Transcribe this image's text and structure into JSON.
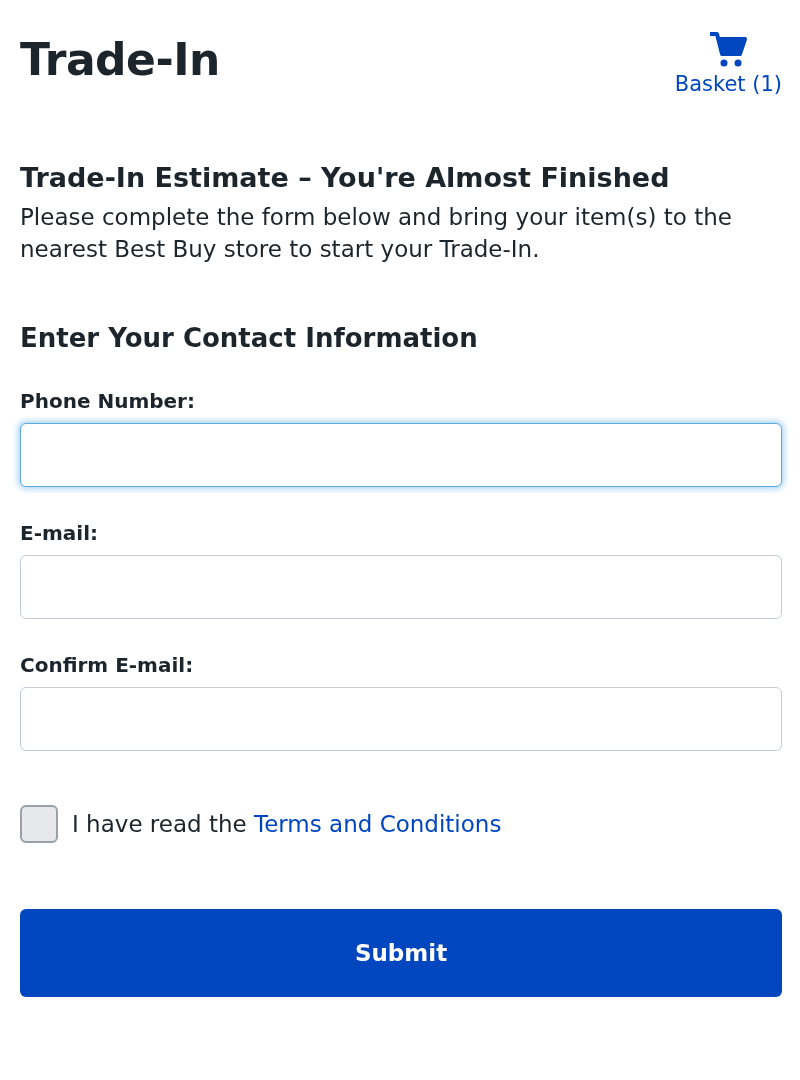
{
  "header": {
    "title": "Trade-In",
    "basket": {
      "label": "Basket (1)"
    }
  },
  "intro": {
    "heading": "Trade-In Estimate – You're Almost Finished",
    "text": "Please complete the form below and bring your item(s) to the nearest Best Buy store to start your Trade-In."
  },
  "form": {
    "heading": "Enter Your Contact Information",
    "fields": [
      {
        "label": "Phone Number:",
        "focused": true
      },
      {
        "label": "E-mail:",
        "focused": false
      },
      {
        "label": "Confirm E-mail:",
        "focused": false
      }
    ],
    "agreement": {
      "checked": false,
      "text": "I have read the",
      "link": "Terms and Conditions"
    },
    "submit": "Submit"
  }
}
